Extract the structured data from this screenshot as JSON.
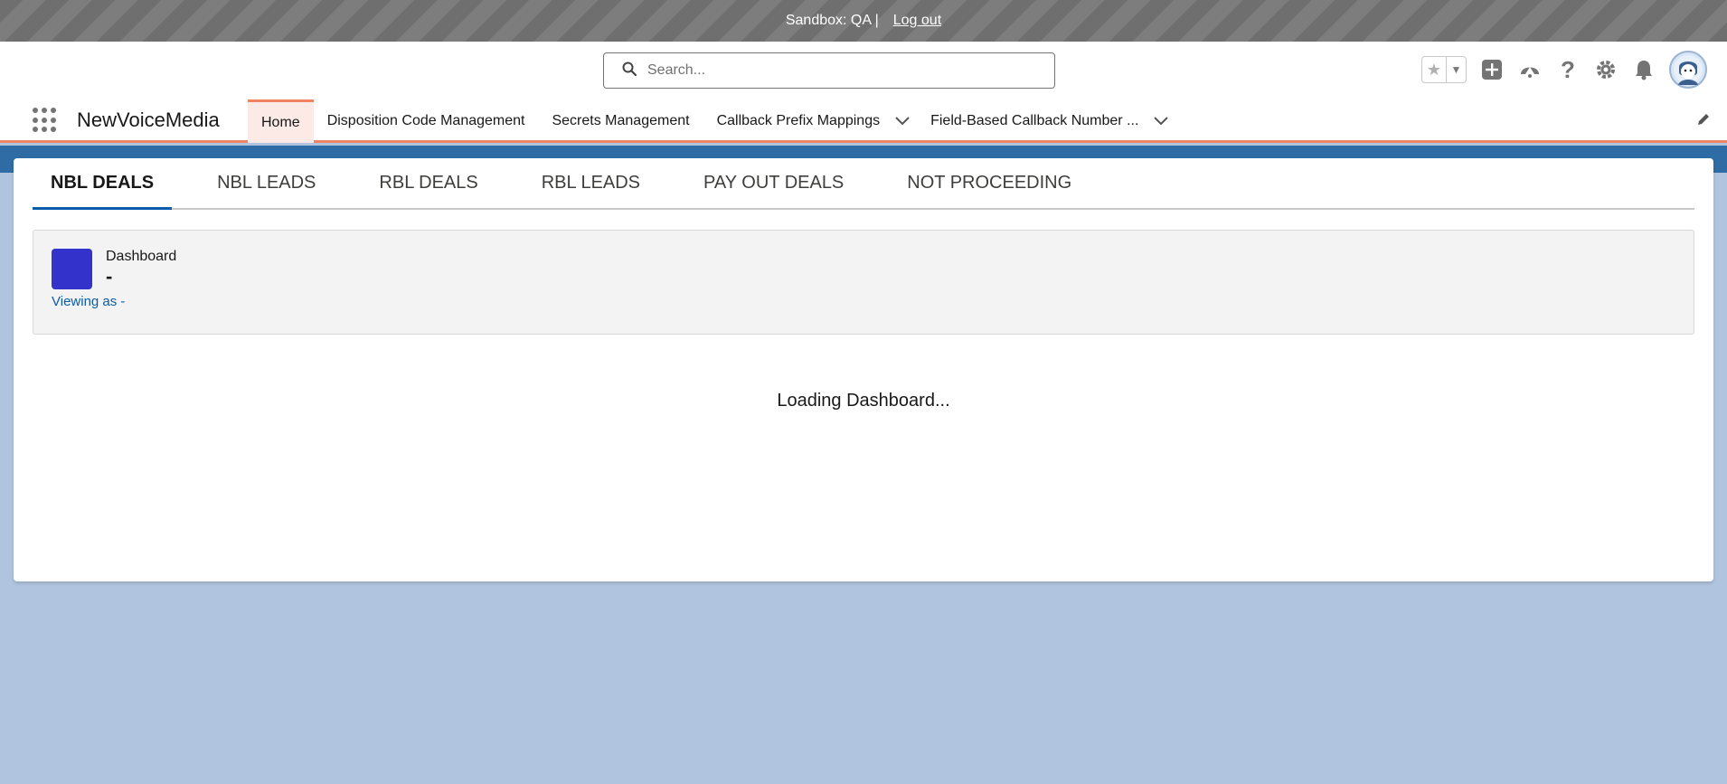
{
  "sandbox": {
    "text": "Sandbox: QA |",
    "logout": "Log out"
  },
  "search": {
    "placeholder": "Search..."
  },
  "app": {
    "name": "NewVoiceMedia"
  },
  "nav": {
    "items": [
      {
        "label": "Home"
      },
      {
        "label": "Disposition Code Management"
      },
      {
        "label": "Secrets Management"
      },
      {
        "label": "Callback Prefix Mappings"
      },
      {
        "label": "Field-Based Callback Number ..."
      }
    ]
  },
  "tabs": [
    {
      "label": "NBL DEALS"
    },
    {
      "label": "NBL LEADS"
    },
    {
      "label": "RBL DEALS"
    },
    {
      "label": "RBL LEADS"
    },
    {
      "label": "PAY OUT DEALS"
    },
    {
      "label": "NOT PROCEEDING"
    }
  ],
  "dashboard": {
    "label": "Dashboard",
    "name": "-",
    "viewing_as": "Viewing as -",
    "loading": "Loading Dashboard...",
    "icon_color": "#3333cc"
  },
  "colors": {
    "accent": "#f08364",
    "brand": "#0b5cab"
  },
  "icons": [
    "search-icon",
    "star-icon",
    "add-icon",
    "trailhead-icon",
    "help-icon",
    "gear-icon",
    "bell-icon",
    "avatar",
    "app-launcher-icon",
    "chevron-down-icon",
    "pencil-icon"
  ]
}
